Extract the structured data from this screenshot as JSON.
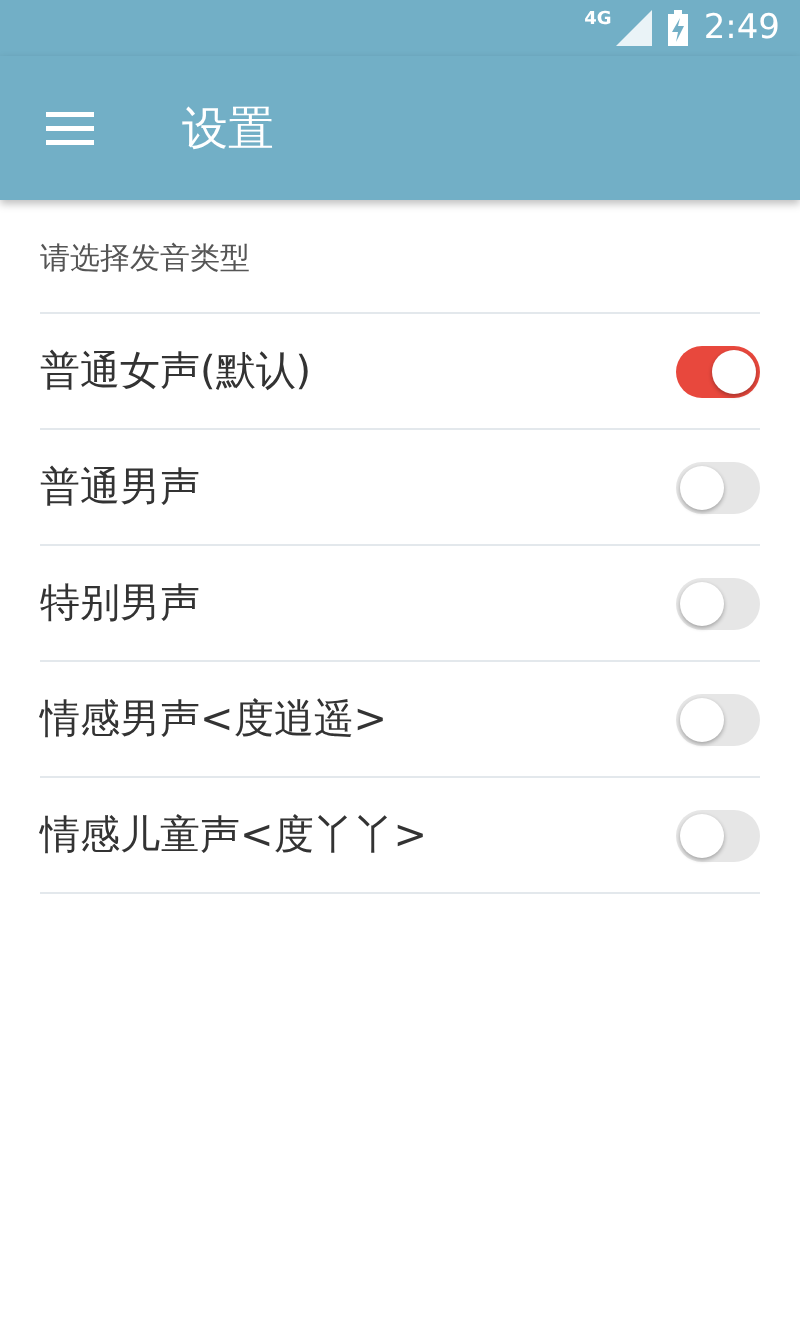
{
  "status_bar": {
    "network": "4G",
    "time": "2:49"
  },
  "app_bar": {
    "title": "设置"
  },
  "section": {
    "title": "请选择发音类型"
  },
  "options": [
    {
      "label": "普通女声(默认)",
      "on": true
    },
    {
      "label": "普通男声",
      "on": false
    },
    {
      "label": "特别男声",
      "on": false
    },
    {
      "label": "情感男声<度逍遥>",
      "on": false
    },
    {
      "label": "情感儿童声<度丫丫>",
      "on": false
    }
  ]
}
